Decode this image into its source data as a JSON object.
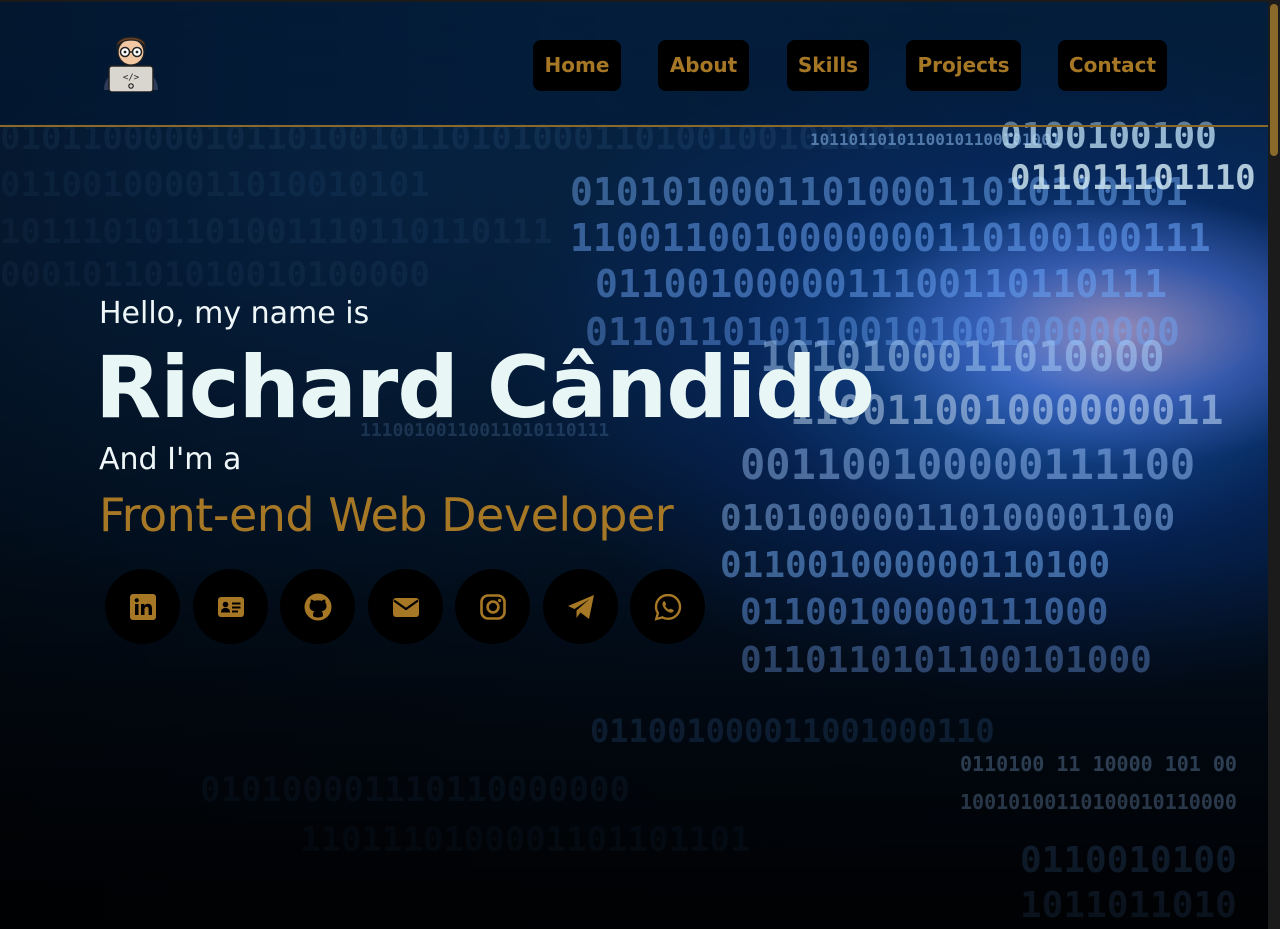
{
  "nav": {
    "items": [
      {
        "label": "Home"
      },
      {
        "label": "About"
      },
      {
        "label": "Skills"
      },
      {
        "label": "Projects"
      },
      {
        "label": "Contact"
      }
    ]
  },
  "hero": {
    "greeting": "Hello, my name is",
    "name": "Richard Cândido",
    "intro": "And I'm a",
    "role": "Front-end Web Developer"
  },
  "social": [
    {
      "icon": "linkedin-icon"
    },
    {
      "icon": "contact-card-icon"
    },
    {
      "icon": "github-icon"
    },
    {
      "icon": "email-icon"
    },
    {
      "icon": "instagram-icon"
    },
    {
      "icon": "telegram-icon"
    },
    {
      "icon": "whatsapp-icon"
    }
  ],
  "colors": {
    "accent": "#a67826",
    "text": "#e8f6f6",
    "button_bg": "#000000"
  }
}
